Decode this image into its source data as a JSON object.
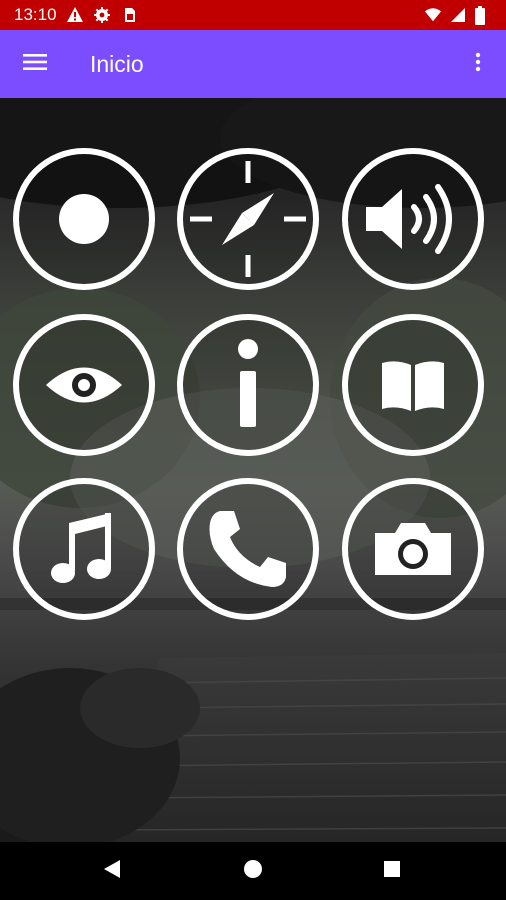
{
  "status_bar": {
    "time": "13:10",
    "left_icons": [
      "warning-icon",
      "settings-icon",
      "sim-card-icon"
    ],
    "right_icons": [
      "wifi-icon",
      "signal-icon",
      "battery-icon"
    ],
    "color": "#c00000"
  },
  "app_bar": {
    "title": "Inicio",
    "menu_icon": "menu-icon",
    "overflow_icon": "more-vert-icon",
    "color": "#7c4dff"
  },
  "tiles": [
    {
      "icon": "record-icon"
    },
    {
      "icon": "compass-icon"
    },
    {
      "icon": "volume-icon"
    },
    {
      "icon": "eye-icon"
    },
    {
      "icon": "info-icon"
    },
    {
      "icon": "book-icon"
    },
    {
      "icon": "music-note-icon"
    },
    {
      "icon": "phone-icon"
    },
    {
      "icon": "camera-icon"
    }
  ],
  "nav_bar": {
    "buttons": [
      "back-icon",
      "home-icon",
      "recents-icon"
    ]
  }
}
